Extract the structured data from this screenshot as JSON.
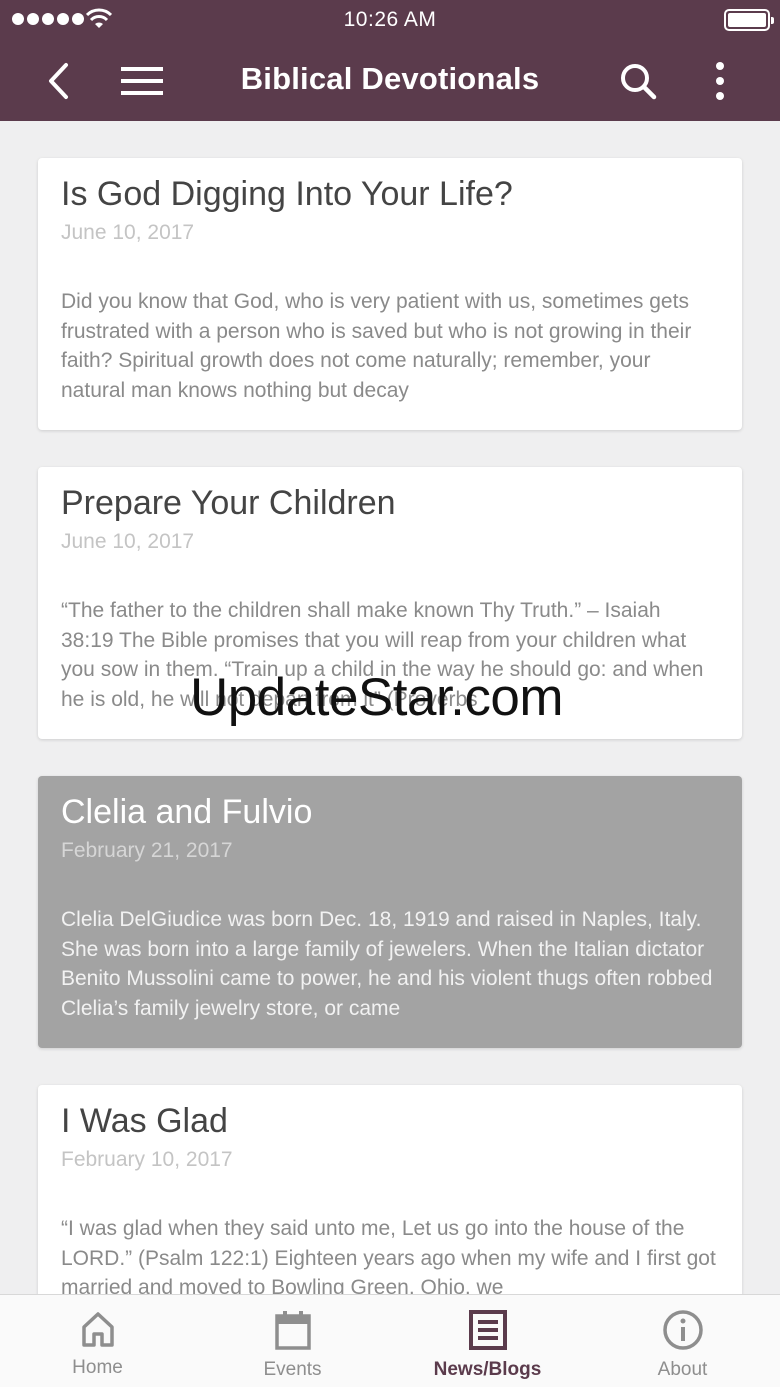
{
  "status_bar": {
    "time": "10:26 AM",
    "signal_icon": "signal-dots-icon",
    "wifi_icon": "wifi-icon",
    "battery_icon": "battery-icon"
  },
  "app_bar": {
    "title": "Biblical Devotionals",
    "back_icon": "chevron-left-icon",
    "menu_icon": "hamburger-menu-icon",
    "search_icon": "search-icon",
    "more_icon": "more-vertical-icon",
    "background": "#5b3b4c"
  },
  "posts": [
    {
      "title": "Is God Digging Into Your Life?",
      "date": "June 10, 2017",
      "excerpt": "Did you know that God, who is very patient with us, sometimes gets frustrated with a person who is saved but who is not growing in their faith? Spiritual growth does not come naturally; remember, your natural man knows nothing but decay"
    },
    {
      "title": "Prepare Your Children",
      "date": "June 10, 2017",
      "excerpt": " “The father to the children shall make known Thy Truth.” – Isaiah 38:19   The Bible promises that you will reap from your children what you sow in them. “Train up a child in the way he should go: and when he is old, he will not depart from it” (Proverbs"
    },
    {
      "title": "Clelia and Fulvio",
      "date": "February 21, 2017",
      "excerpt": "Clelia DelGiudice was born Dec. 18, 1919 and raised in Naples, Italy. She was born into a large family of jewelers. When the Italian dictator Benito Mussolini came to power, he and his violent thugs often robbed Clelia’s family jewelry store, or came",
      "selected": true
    },
    {
      "title": "I Was Glad",
      "date": "February 10, 2017",
      "excerpt": " “I was glad when they said unto me, Let us go into the house of the LORD.” (Psalm 122:1)   Eighteen years ago when my wife and I first got married and moved to Bowling Green, Ohio, we"
    }
  ],
  "watermark": "UpdateStar.com",
  "tab_bar": {
    "tabs": [
      {
        "label": "Home",
        "icon": "home-icon"
      },
      {
        "label": "Events",
        "icon": "calendar-icon"
      },
      {
        "label": "News/Blogs",
        "icon": "newspaper-icon",
        "active": true
      },
      {
        "label": "About",
        "icon": "info-icon"
      }
    ],
    "active_color": "#5b3b4c",
    "inactive_color": "#8e8e8e"
  }
}
